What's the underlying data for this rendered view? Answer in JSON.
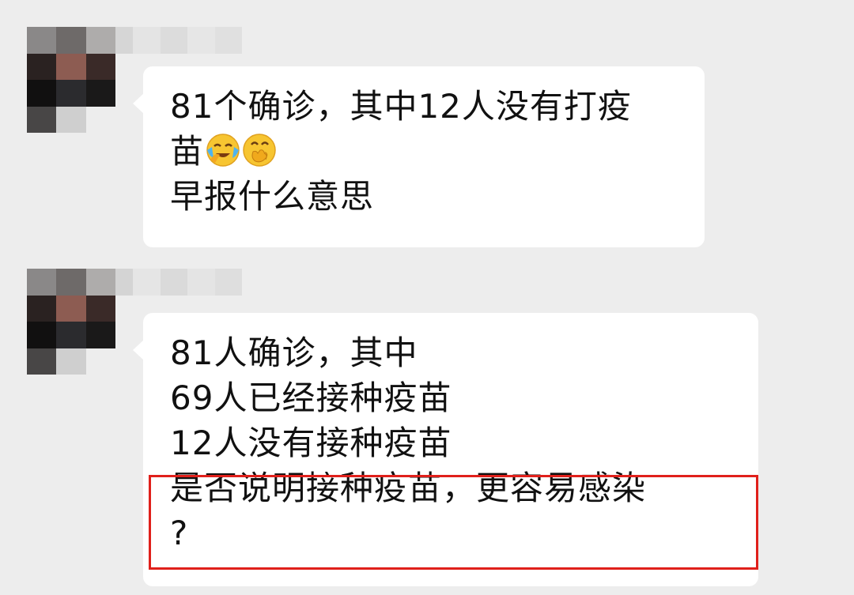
{
  "colors": {
    "background": "#ededed",
    "bubble": "#ffffff",
    "text": "#111111",
    "highlight": "#e0201b"
  },
  "messages": [
    {
      "line_1": "81个确诊，其中12人没有打疫",
      "line_2_text": "苗",
      "line_2_emojis": [
        "face-with-tears-emoji",
        "face-with-hand-over-mouth-emoji"
      ],
      "line_3": "早报什么意思"
    },
    {
      "line_1": "81人确诊，其中",
      "line_2": "69人已经接种疫苗",
      "line_3": "12人没有接种疫苗",
      "line_4": "是否说明接种疫苗，更容易感染",
      "line_5": "?"
    }
  ]
}
